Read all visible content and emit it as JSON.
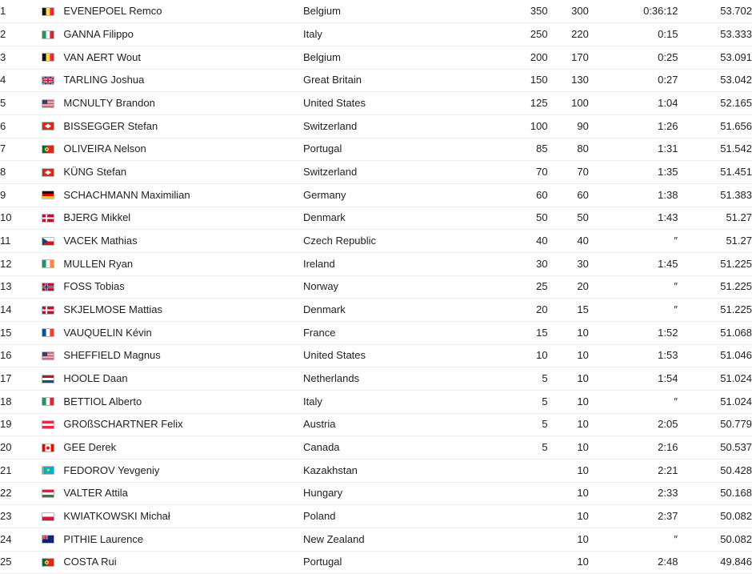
{
  "table": {
    "columns": [
      "rank",
      "flag",
      "rider",
      "country",
      "points_uci",
      "points_ranking",
      "time",
      "avg_speed"
    ],
    "rows": [
      {
        "rank": "1",
        "flag": "be",
        "rider": "EVENEPOEL Remco",
        "country": "Belgium",
        "pts1": "350",
        "pts2": "300",
        "time": "0:36:12",
        "speed": "53.702"
      },
      {
        "rank": "2",
        "flag": "it",
        "rider": "GANNA Filippo",
        "country": "Italy",
        "pts1": "250",
        "pts2": "220",
        "time": "0:15",
        "speed": "53.333"
      },
      {
        "rank": "3",
        "flag": "be",
        "rider": "VAN AERT Wout",
        "country": "Belgium",
        "pts1": "200",
        "pts2": "170",
        "time": "0:25",
        "speed": "53.091"
      },
      {
        "rank": "4",
        "flag": "gb",
        "rider": "TARLING Joshua",
        "country": "Great Britain",
        "pts1": "150",
        "pts2": "130",
        "time": "0:27",
        "speed": "53.042"
      },
      {
        "rank": "5",
        "flag": "us",
        "rider": "MCNULTY Brandon",
        "country": "United States",
        "pts1": "125",
        "pts2": "100",
        "time": "1:04",
        "speed": "52.165"
      },
      {
        "rank": "6",
        "flag": "ch",
        "rider": "BISSEGGER Stefan",
        "country": "Switzerland",
        "pts1": "100",
        "pts2": "90",
        "time": "1:26",
        "speed": "51.656"
      },
      {
        "rank": "7",
        "flag": "pt",
        "rider": "OLIVEIRA Nelson",
        "country": "Portugal",
        "pts1": "85",
        "pts2": "80",
        "time": "1:31",
        "speed": "51.542"
      },
      {
        "rank": "8",
        "flag": "ch",
        "rider": "KÜNG Stefan",
        "country": "Switzerland",
        "pts1": "70",
        "pts2": "70",
        "time": "1:35",
        "speed": "51.451"
      },
      {
        "rank": "9",
        "flag": "de",
        "rider": "SCHACHMANN Maximilian",
        "country": "Germany",
        "pts1": "60",
        "pts2": "60",
        "time": "1:38",
        "speed": "51.383"
      },
      {
        "rank": "10",
        "flag": "dk",
        "rider": "BJERG Mikkel",
        "country": "Denmark",
        "pts1": "50",
        "pts2": "50",
        "time": "1:43",
        "speed": "51.27"
      },
      {
        "rank": "11",
        "flag": "cz",
        "rider": "VACEK Mathias",
        "country": "Czech Republic",
        "pts1": "40",
        "pts2": "40",
        "time": "″",
        "speed": "51.27"
      },
      {
        "rank": "12",
        "flag": "ie",
        "rider": "MULLEN Ryan",
        "country": "Ireland",
        "pts1": "30",
        "pts2": "30",
        "time": "1:45",
        "speed": "51.225"
      },
      {
        "rank": "13",
        "flag": "no",
        "rider": "FOSS Tobias",
        "country": "Norway",
        "pts1": "25",
        "pts2": "20",
        "time": "″",
        "speed": "51.225"
      },
      {
        "rank": "14",
        "flag": "dk",
        "rider": "SKJELMOSE Mattias",
        "country": "Denmark",
        "pts1": "20",
        "pts2": "15",
        "time": "″",
        "speed": "51.225"
      },
      {
        "rank": "15",
        "flag": "fr",
        "rider": "VAUQUELIN Kévin",
        "country": "France",
        "pts1": "15",
        "pts2": "10",
        "time": "1:52",
        "speed": "51.068"
      },
      {
        "rank": "16",
        "flag": "us",
        "rider": "SHEFFIELD Magnus",
        "country": "United States",
        "pts1": "10",
        "pts2": "10",
        "time": "1:53",
        "speed": "51.046"
      },
      {
        "rank": "17",
        "flag": "nl",
        "rider": "HOOLE Daan",
        "country": "Netherlands",
        "pts1": "5",
        "pts2": "10",
        "time": "1:54",
        "speed": "51.024"
      },
      {
        "rank": "18",
        "flag": "it",
        "rider": "BETTIOL Alberto",
        "country": "Italy",
        "pts1": "5",
        "pts2": "10",
        "time": "″",
        "speed": "51.024"
      },
      {
        "rank": "19",
        "flag": "at",
        "rider": "GROßSCHARTNER Felix",
        "country": "Austria",
        "pts1": "5",
        "pts2": "10",
        "time": "2:05",
        "speed": "50.779"
      },
      {
        "rank": "20",
        "flag": "ca",
        "rider": "GEE Derek",
        "country": "Canada",
        "pts1": "5",
        "pts2": "10",
        "time": "2:16",
        "speed": "50.537"
      },
      {
        "rank": "21",
        "flag": "kz",
        "rider": "FEDOROV Yevgeniy",
        "country": "Kazakhstan",
        "pts1": "",
        "pts2": "10",
        "time": "2:21",
        "speed": "50.428"
      },
      {
        "rank": "22",
        "flag": "hu",
        "rider": "VALTER Attila",
        "country": "Hungary",
        "pts1": "",
        "pts2": "10",
        "time": "2:33",
        "speed": "50.168"
      },
      {
        "rank": "23",
        "flag": "pl",
        "rider": "KWIATKOWSKI Michał",
        "country": "Poland",
        "pts1": "",
        "pts2": "10",
        "time": "2:37",
        "speed": "50.082"
      },
      {
        "rank": "24",
        "flag": "nz",
        "rider": "PITHIE Laurence",
        "country": "New Zealand",
        "pts1": "",
        "pts2": "10",
        "time": "″",
        "speed": "50.082"
      },
      {
        "rank": "25",
        "flag": "pt",
        "rider": "COSTA Rui",
        "country": "Portugal",
        "pts1": "",
        "pts2": "10",
        "time": "2:48",
        "speed": "49.846"
      }
    ]
  },
  "flag_names": {
    "be": "flag-belgium",
    "it": "flag-italy",
    "gb": "flag-great-britain",
    "us": "flag-united-states",
    "ch": "flag-switzerland",
    "pt": "flag-portugal",
    "de": "flag-germany",
    "dk": "flag-denmark",
    "cz": "flag-czech-republic",
    "ie": "flag-ireland",
    "no": "flag-norway",
    "fr": "flag-france",
    "nl": "flag-netherlands",
    "at": "flag-austria",
    "ca": "flag-canada",
    "kz": "flag-kazakhstan",
    "hu": "flag-hungary",
    "pl": "flag-poland",
    "nz": "flag-new-zealand"
  },
  "colors": {
    "text": "#222222",
    "row_separator": "#ededed",
    "background": "#ffffff",
    "flag_border": "#b9b9b9"
  }
}
